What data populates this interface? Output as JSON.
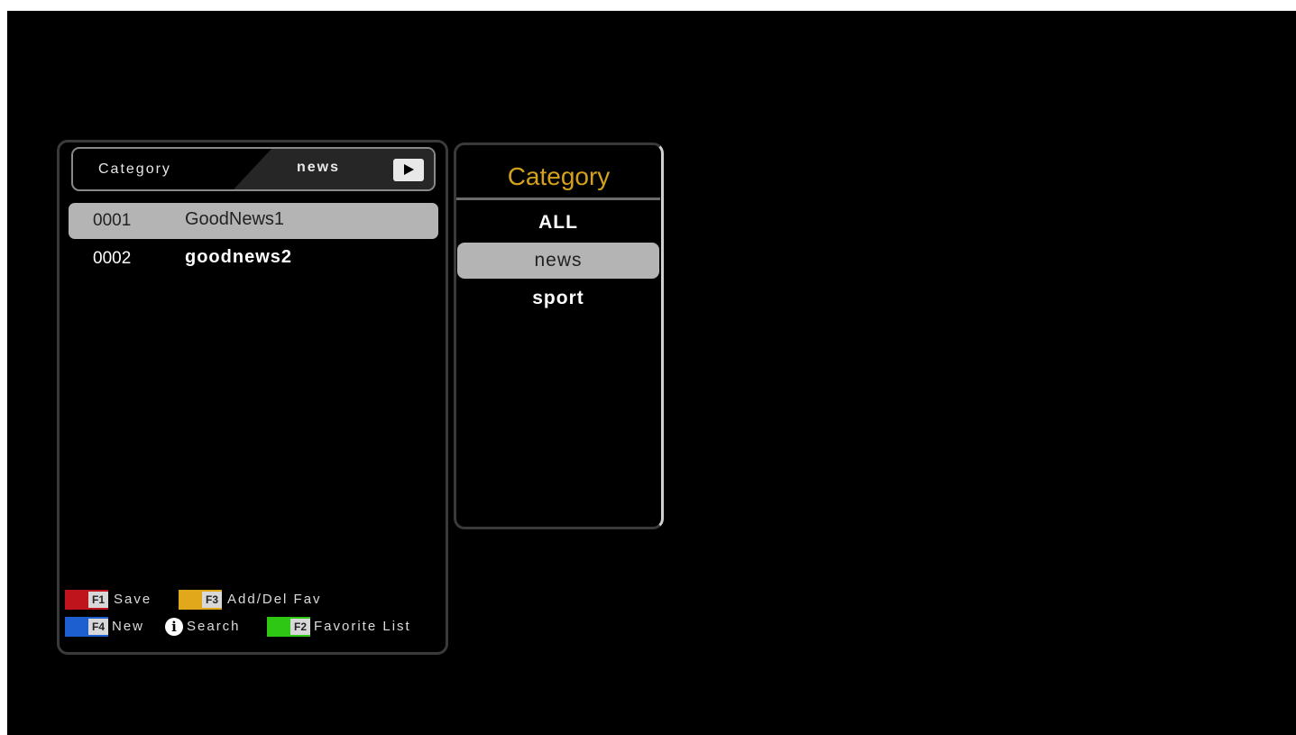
{
  "channel_panel": {
    "header": {
      "label": "Category",
      "value": "news"
    },
    "channels": [
      {
        "number": "0001",
        "name": "GoodNews1",
        "selected": true
      },
      {
        "number": "0002",
        "name": "goodnews2",
        "selected": false
      }
    ],
    "legend": {
      "f1": {
        "key": "F1",
        "label": "Save",
        "color": "#c0141c"
      },
      "f3": {
        "key": "F3",
        "label": "Add/Del Fav",
        "color": "#e0a81a"
      },
      "f4": {
        "key": "F4",
        "label": "New",
        "color": "#1d5fd0"
      },
      "info": {
        "icon": "info-icon",
        "label": "Search"
      },
      "f2": {
        "key": "F2",
        "label": "Favorite List",
        "color": "#2ec814"
      }
    }
  },
  "category_panel": {
    "title": "Category",
    "title_color": "#d4a21a",
    "items": [
      "ALL",
      "news",
      "sport"
    ],
    "selected": "news"
  }
}
